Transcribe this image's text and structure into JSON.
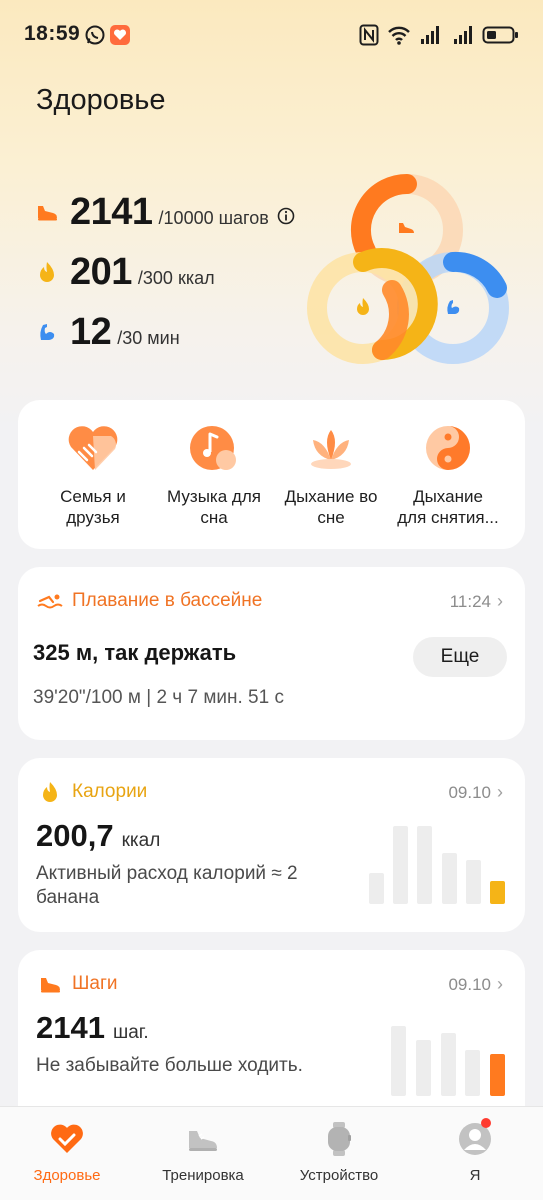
{
  "status_bar": {
    "time": "18:59"
  },
  "page": {
    "title": "Здоровье"
  },
  "stats": {
    "steps": {
      "value": "2141",
      "goal": "/10000 шагов"
    },
    "calories": {
      "value": "201",
      "goal": "/300 ккал"
    },
    "activity": {
      "value": "12",
      "goal": "/30 мин"
    }
  },
  "rings": {
    "steps_fraction": 0.21,
    "calories_fraction": 0.67,
    "activity_fraction": 0.4
  },
  "shortcuts": [
    {
      "label_line1": "Семья и",
      "label_line2": "друзья"
    },
    {
      "label_line1": "Музыка для",
      "label_line2": "сна"
    },
    {
      "label_line1": "Дыхание во",
      "label_line2": "сне"
    },
    {
      "label_line1": "Дыхание",
      "label_line2": "для снятия..."
    }
  ],
  "swim_card": {
    "title": "Плавание в бассейне",
    "time": "11:24",
    "headline": "325 м, так держать",
    "more_label": "Еще",
    "details": "39'20\"/100 м | 2 ч 7 мин. 51 с"
  },
  "calories_card": {
    "title": "Калории",
    "date": "09.10",
    "value": "200,7",
    "unit": "ккал",
    "note": "Активный расход калорий ≈ 2 банана",
    "bars": [
      0.4,
      1.0,
      1.0,
      0.65,
      0.57,
      0.3
    ]
  },
  "steps_card": {
    "title": "Шаги",
    "date": "09.10",
    "value": "2141",
    "unit": "шаг.",
    "note": "Не забывайте больше ходить.",
    "bars": [
      1.0,
      0.8,
      0.9,
      0.65,
      0.6
    ]
  },
  "bottom_nav": [
    {
      "label": "Здоровье"
    },
    {
      "label": "Тренировка"
    },
    {
      "label": "Устройство"
    },
    {
      "label": "Я"
    }
  ],
  "colors": {
    "orange": "#ff7a1f",
    "yellow": "#f5b417",
    "blue": "#3d8ef0",
    "active_nav": "#ff6a13"
  }
}
